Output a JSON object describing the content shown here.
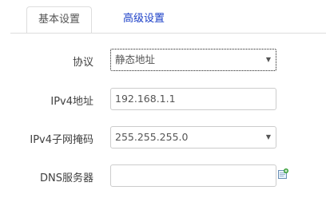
{
  "tabs": {
    "basic_label": "基本设置",
    "advanced_label": "高级设置"
  },
  "form": {
    "protocol": {
      "label": "协议",
      "value": "静态地址"
    },
    "ipv4_address": {
      "label": "IPv4地址",
      "value": "192.168.1.1"
    },
    "ipv4_netmask": {
      "label": "IPv4子网掩码",
      "value": "255.255.255.0"
    },
    "dns_servers": {
      "label": "DNS服务器",
      "value": ""
    }
  },
  "icons": {
    "caret": "caret-down-icon",
    "add": "add-entry-icon"
  },
  "colors": {
    "tab_active_text": "#555555",
    "tab_link": "#1a3ec7",
    "border": "#cccccc",
    "add_icon_green": "#2e9b2e"
  }
}
